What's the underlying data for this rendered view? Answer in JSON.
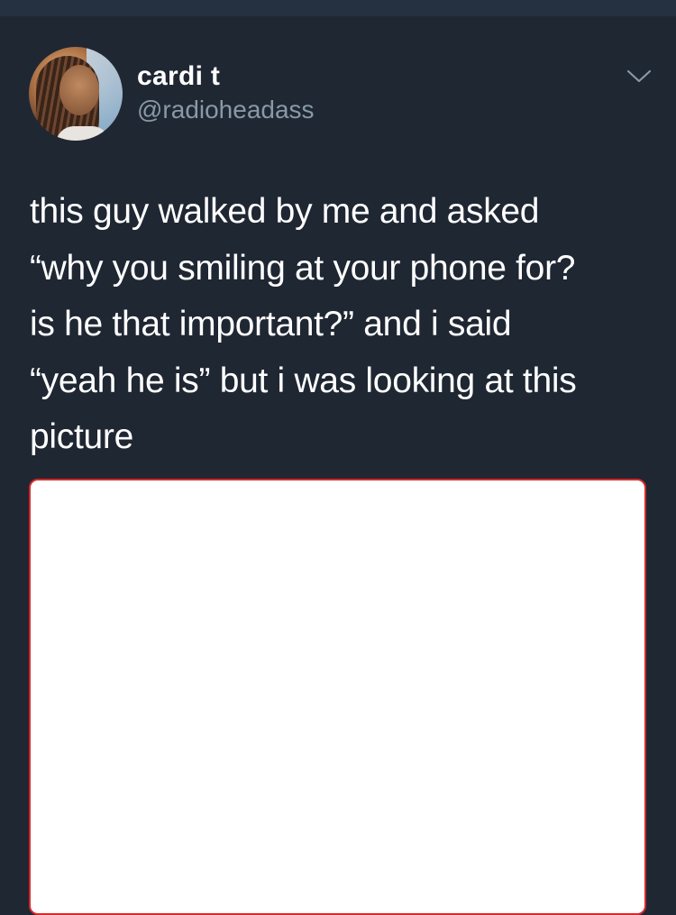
{
  "tweet": {
    "display_name": "cardi t",
    "handle": "@radioheadass",
    "text": "this guy walked by me and asked\n“why you smiling at your phone for?\nis he that important?” and i said\n“yeah he is” but i was looking at this\npicture",
    "menu_icon": "chevron-down-icon"
  },
  "colors": {
    "background": "#1f2733",
    "text": "#ffffff",
    "handle": "#8899a6",
    "media_border": "#d62a2a"
  }
}
